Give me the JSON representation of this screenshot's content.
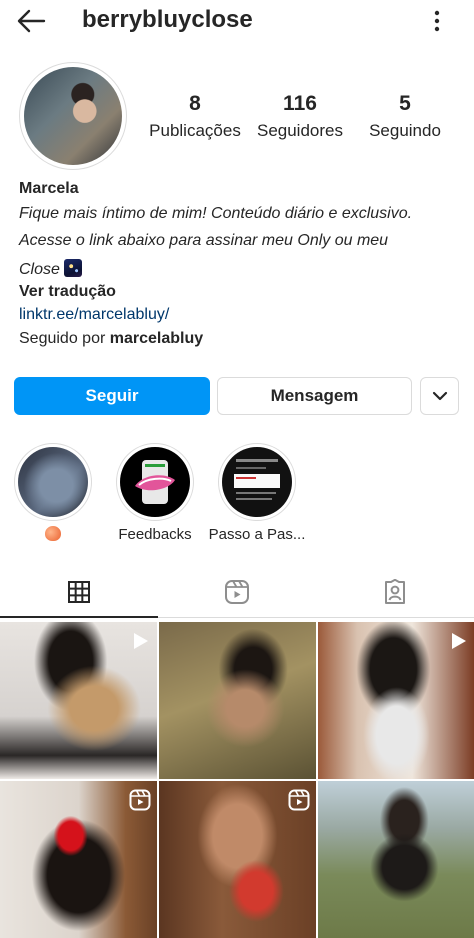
{
  "header": {
    "username": "berrybluyclose"
  },
  "stats": [
    {
      "value": "8",
      "label": "Publicações"
    },
    {
      "value": "116",
      "label": "Seguidores"
    },
    {
      "value": "5",
      "label": "Seguindo"
    }
  ],
  "bio": {
    "name": "Marcela",
    "line1": "Fique mais íntimo de mim! Conteúdo diário e exclusivo.",
    "line2": "Acesse o link abaixo para assinar meu Only ou meu",
    "line3": "Close",
    "translate": "Ver tradução",
    "link": "linktr.ee/marcelabluy/",
    "followed_by_prefix": "Seguido por",
    "followed_by_user": "marcelabluy"
  },
  "buttons": {
    "follow": "Seguir",
    "message": "Mensagem"
  },
  "highlights": [
    {
      "caption": ""
    },
    {
      "caption": "Feedbacks"
    },
    {
      "caption": "Passo a Pas..."
    }
  ],
  "tabs": {
    "active": "grid"
  },
  "colors": {
    "accent": "#0095f6",
    "link": "#00376b",
    "border": "#dbdbdb",
    "text": "#262626"
  }
}
